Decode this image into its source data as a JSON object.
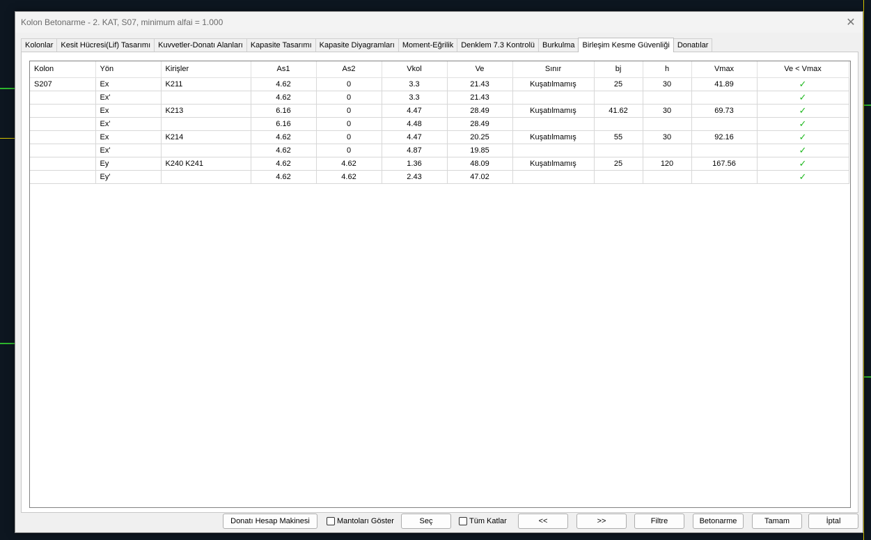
{
  "window": {
    "title": "Kolon Betonarme - 2. KAT, S07, minimum alfai = 1.000",
    "close_icon": "✕"
  },
  "tabs": [
    {
      "label": "Kolonlar",
      "active": false
    },
    {
      "label": "Kesit Hücresi(Lif) Tasarımı",
      "active": false
    },
    {
      "label": "Kuvvetler-Donatı Alanları",
      "active": false
    },
    {
      "label": "Kapasite Tasarımı",
      "active": false
    },
    {
      "label": "Kapasite Diyagramları",
      "active": false
    },
    {
      "label": "Moment-Eğrilik",
      "active": false
    },
    {
      "label": "Denklem 7.3 Kontrolü",
      "active": false
    },
    {
      "label": "Burkulma",
      "active": false
    },
    {
      "label": "Birleşim Kesme Güvenliği",
      "active": true
    },
    {
      "label": "Donatılar",
      "active": false
    }
  ],
  "table": {
    "columns": [
      "Kolon",
      "Yön",
      "Kirişler",
      "As1",
      "As2",
      "Vkol",
      "Ve",
      "Sınır",
      "bj",
      "h",
      "Vmax",
      "Ve < Vmax"
    ],
    "rows": [
      {
        "kolon": "S207",
        "yon": "Ex",
        "kirisler": "K211",
        "as1": "4.62",
        "as2": "0",
        "vkol": "3.3",
        "ve": "21.43",
        "sinir": "Kuşatılmamış",
        "bj": "25",
        "h": "30",
        "vmax": "41.89",
        "ok": "✓"
      },
      {
        "kolon": "",
        "yon": "Ex'",
        "kirisler": "",
        "as1": "4.62",
        "as2": "0",
        "vkol": "3.3",
        "ve": "21.43",
        "sinir": "",
        "bj": "",
        "h": "",
        "vmax": "",
        "ok": "✓"
      },
      {
        "kolon": "",
        "yon": "Ex",
        "kirisler": "K213",
        "as1": "6.16",
        "as2": "0",
        "vkol": "4.47",
        "ve": "28.49",
        "sinir": "Kuşatılmamış",
        "bj": "41.62",
        "h": "30",
        "vmax": "69.73",
        "ok": "✓"
      },
      {
        "kolon": "",
        "yon": "Ex'",
        "kirisler": "",
        "as1": "6.16",
        "as2": "0",
        "vkol": "4.48",
        "ve": "28.49",
        "sinir": "",
        "bj": "",
        "h": "",
        "vmax": "",
        "ok": "✓"
      },
      {
        "kolon": "",
        "yon": "Ex",
        "kirisler": "K214",
        "as1": "4.62",
        "as2": "0",
        "vkol": "4.47",
        "ve": "20.25",
        "sinir": "Kuşatılmamış",
        "bj": "55",
        "h": "30",
        "vmax": "92.16",
        "ok": "✓"
      },
      {
        "kolon": "",
        "yon": "Ex'",
        "kirisler": "",
        "as1": "4.62",
        "as2": "0",
        "vkol": "4.87",
        "ve": "19.85",
        "sinir": "",
        "bj": "",
        "h": "",
        "vmax": "",
        "ok": "✓"
      },
      {
        "kolon": "",
        "yon": "Ey",
        "kirisler": "K240 K241",
        "as1": "4.62",
        "as2": "4.62",
        "vkol": "1.36",
        "ve": "48.09",
        "sinir": "Kuşatılmamış",
        "bj": "25",
        "h": "120",
        "vmax": "167.56",
        "ok": "✓"
      },
      {
        "kolon": "",
        "yon": "Ey'",
        "kirisler": "",
        "as1": "4.62",
        "as2": "4.62",
        "vkol": "2.43",
        "ve": "47.02",
        "sinir": "",
        "bj": "",
        "h": "",
        "vmax": "",
        "ok": "✓"
      }
    ]
  },
  "footer": {
    "calc_button": "Donatı Hesap Makinesi",
    "mantolar_checkbox": "Mantoları Göster",
    "sec_button": "Seç",
    "tum_katlar_checkbox": "Tüm Katlar",
    "prev_button": "<<",
    "next_button": ">>",
    "filtre_button": "Filtre",
    "betonarme_button": "Betonarme",
    "tamam_button": "Tamam",
    "iptal_button": "İptal"
  },
  "colors": {
    "check": "#1fb81f",
    "cad_background": "#0d1620"
  }
}
